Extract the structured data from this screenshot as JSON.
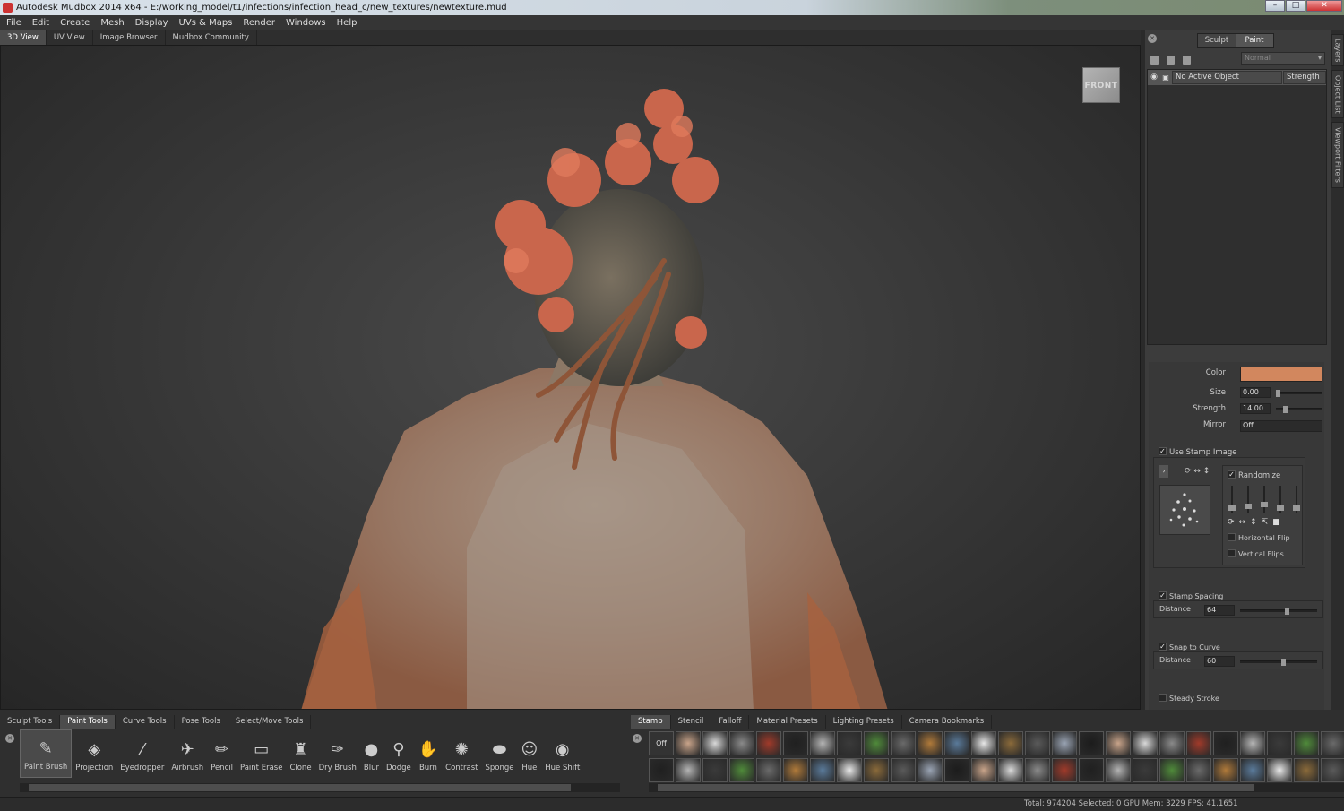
{
  "titlebar": {
    "text": "Autodesk Mudbox 2014 x64 - E:/working_model/t1/infections/infection_head_c/new_textures/newtexture.mud"
  },
  "menu": [
    "File",
    "Edit",
    "Create",
    "Mesh",
    "Display",
    "UVs & Maps",
    "Render",
    "Windows",
    "Help"
  ],
  "view_tabs": [
    "3D View",
    "UV View",
    "Image Browser",
    "Mudbox Community"
  ],
  "viewport": {
    "cube_label": "FRONT"
  },
  "right_panel": {
    "mode_tabs": [
      "Sculpt",
      "Paint"
    ],
    "blend_mode": "Normal",
    "layer_row": {
      "name": "No Active Object",
      "strength_header": "Strength"
    },
    "side_tabs": [
      "Layers",
      "Object List",
      "Viewport Filters"
    ]
  },
  "properties": {
    "color_label": "Color",
    "color_value": "#d2875e",
    "size_label": "Size",
    "size_value": "0.00",
    "strength_label": "Strength",
    "strength_value": "14.00",
    "mirror_label": "Mirror",
    "mirror_value": "Off",
    "use_stamp_label": "Use Stamp Image",
    "randomize_label": "Randomize",
    "hflip_label": "Horizontal Flip",
    "vflip_label": "Vertical Flips",
    "stamp_spacing_label": "Stamp Spacing",
    "stamp_distance_label": "Distance",
    "stamp_distance_value": "64",
    "snap_label": "Snap to Curve",
    "snap_distance_label": "Distance",
    "snap_distance_value": "60",
    "steady_label": "Steady Stroke"
  },
  "tool_tabs": [
    "Sculpt Tools",
    "Paint Tools",
    "Curve Tools",
    "Pose Tools",
    "Select/Move Tools"
  ],
  "tools": [
    {
      "label": "Paint Brush",
      "icon": "✎",
      "active": true
    },
    {
      "label": "Projection",
      "icon": "◈"
    },
    {
      "label": "Eyedropper",
      "icon": "⁄"
    },
    {
      "label": "Airbrush",
      "icon": "✈"
    },
    {
      "label": "Pencil",
      "icon": "✏"
    },
    {
      "label": "Paint Erase",
      "icon": "▭"
    },
    {
      "label": "Clone",
      "icon": "♜"
    },
    {
      "label": "Dry Brush",
      "icon": "✑"
    },
    {
      "label": "Blur",
      "icon": "●"
    },
    {
      "label": "Dodge",
      "icon": "⚲"
    },
    {
      "label": "Burn",
      "icon": "✋"
    },
    {
      "label": "Contrast",
      "icon": "✺"
    },
    {
      "label": "Sponge",
      "icon": "⬬"
    },
    {
      "label": "Hue",
      "icon": "☺"
    },
    {
      "label": "Hue Shift",
      "icon": "◉"
    }
  ],
  "stamp_tabs": [
    "Stamp",
    "Stencil",
    "Falloff",
    "Material Presets",
    "Lighting Presets",
    "Camera Bookmarks"
  ],
  "stamp_off_label": "Off",
  "status": {
    "text": "Total: 974204  Selected: 0 GPU Mem: 3229  FPS: 41.1651"
  },
  "colors": {
    "accent_color_swatch": "#d2875e"
  }
}
